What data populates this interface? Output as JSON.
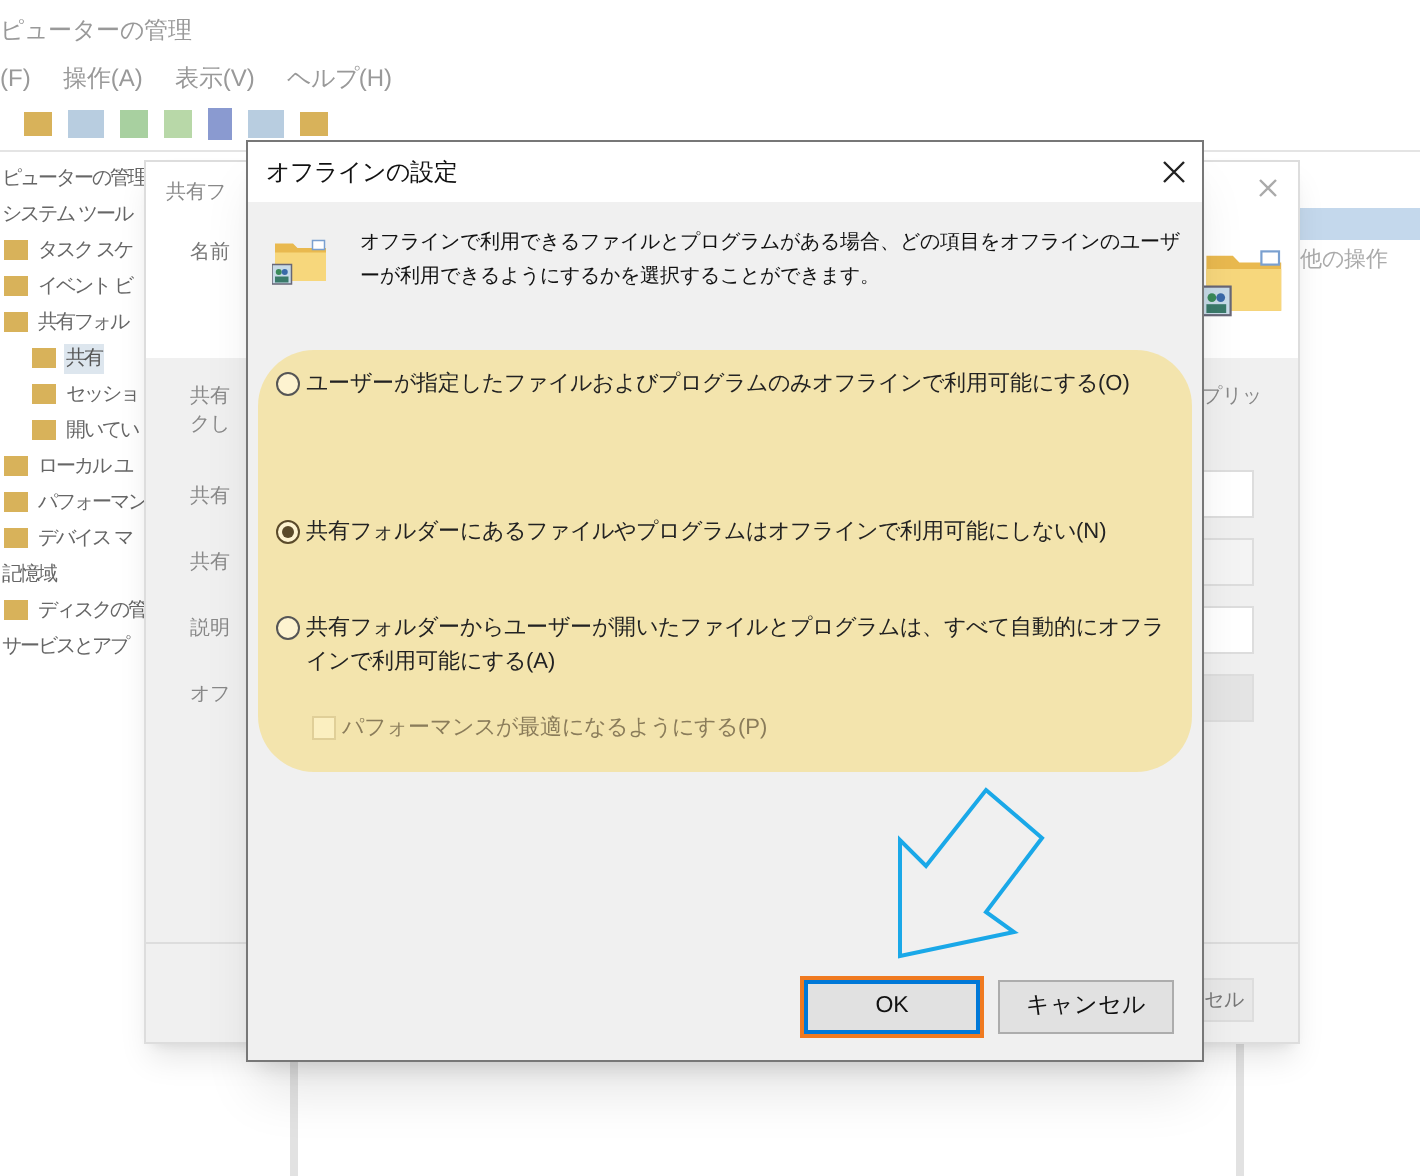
{
  "main_window": {
    "title": "ピューターの管理",
    "menu": [
      "(F)",
      "操作(A)",
      "表示(V)",
      "ヘルプ(H)"
    ],
    "tree": [
      {
        "label": "ピューターの管理",
        "selected": false,
        "children": [
          {
            "label": "システム ツール",
            "selected": false,
            "children": [
              {
                "label": "タスク スケ",
                "selected": false
              },
              {
                "label": "イベント ビ",
                "selected": false
              },
              {
                "label": "共有フォル",
                "selected": false,
                "children": [
                  {
                    "label": "共有",
                    "selected": true
                  },
                  {
                    "label": "セッショ",
                    "selected": false
                  },
                  {
                    "label": "開いてい",
                    "selected": false
                  }
                ]
              },
              {
                "label": "ローカル ユ",
                "selected": false
              },
              {
                "label": "パフォーマン",
                "selected": false
              },
              {
                "label": "デバイス マ",
                "selected": false
              }
            ]
          },
          {
            "label": "記憶域",
            "selected": false,
            "children": [
              {
                "label": "ディスクの管",
                "selected": false
              }
            ]
          },
          {
            "label": "サービスとアプ",
            "selected": false
          }
        ]
      }
    ],
    "actions_pane": {
      "heading": "他の操作"
    }
  },
  "properties_window": {
    "title": "共有フ",
    "name_label": "名前",
    "intro_lines": [
      "共有",
      "クし"
    ],
    "intro_right": "プリッ",
    "field_labels": [
      "共有",
      "共有",
      "説明",
      "オフ"
    ],
    "cancel_button": "セル"
  },
  "dialog": {
    "title": "オフラインの設定",
    "description": "オフラインで利用できるファイルとプログラムがある場合、どの項目をオフラインのユーザーが利用できるようにするかを選択することができます。",
    "options": [
      {
        "kind": "radio",
        "label": "ユーザーが指定したファイルおよびプログラムのみオフラインで利用可能にする(O)",
        "selected": false
      },
      {
        "kind": "radio",
        "label": "共有フォルダーにあるファイルやプログラムはオフラインで利用可能にしない(N)",
        "selected": true
      },
      {
        "kind": "radio",
        "label": "共有フォルダーからユーザーが開いたファイルとプログラムは、すべて自動的にオフラインで利用可能にする(A)",
        "selected": false
      },
      {
        "kind": "checkbox",
        "label": "パフォーマンスが最適になるようにする(P)",
        "checked": false,
        "disabled": true
      }
    ],
    "buttons": [
      {
        "label": "OK",
        "focused": true
      },
      {
        "label": "キャンセル",
        "focused": false
      }
    ]
  }
}
